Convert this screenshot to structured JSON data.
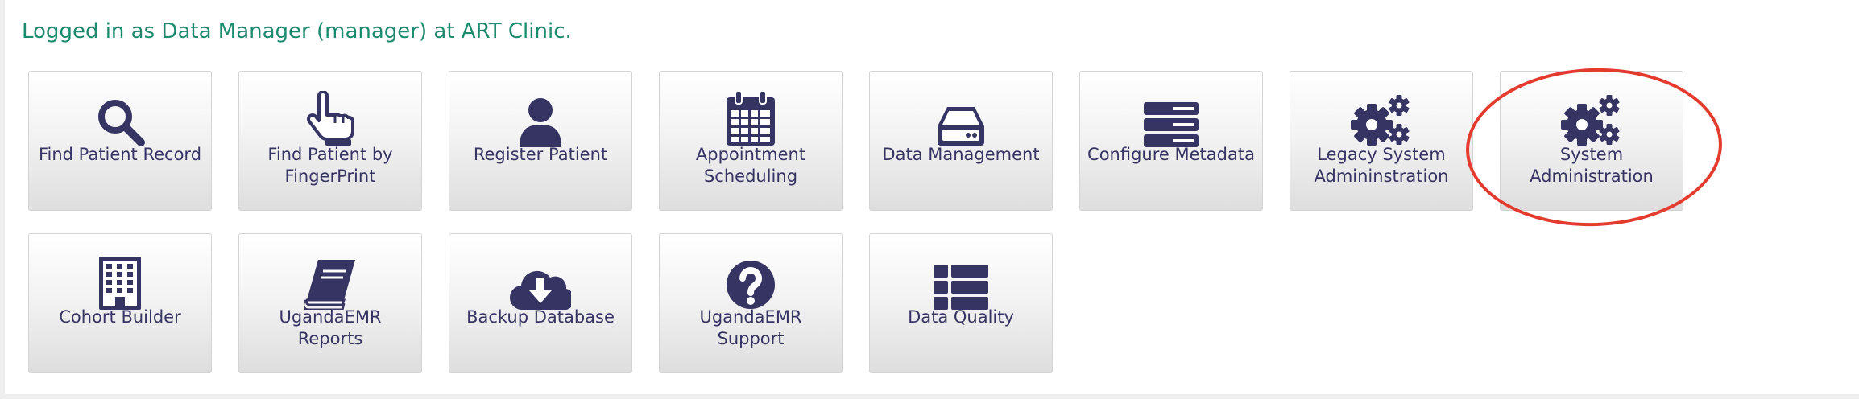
{
  "header": {
    "welcome": "Logged in as Data Manager (manager) at ART Clinic."
  },
  "colors": {
    "icon": "#363463",
    "welcome_text": "#1b8a6e",
    "highlight_ring": "#e33b2e"
  },
  "apps": [
    {
      "label": "Find Patient Record",
      "icon": "search-icon"
    },
    {
      "label": "Find Patient by FingerPrint",
      "icon": "pointing-hand-icon"
    },
    {
      "label": "Register Patient",
      "icon": "user-icon"
    },
    {
      "label": "Appointment Scheduling",
      "icon": "calendar-icon"
    },
    {
      "label": "Data Management",
      "icon": "hard-drive-icon"
    },
    {
      "label": "Configure Metadata",
      "icon": "server-icon"
    },
    {
      "label": "Legacy System Admininstration",
      "icon": "gears-icon"
    },
    {
      "label": "System Administration",
      "icon": "gears-icon"
    },
    {
      "label": "Cohort Builder",
      "icon": "building-icon"
    },
    {
      "label": "UgandaEMR Reports",
      "icon": "book-icon"
    },
    {
      "label": "Backup Database",
      "icon": "cloud-download-icon"
    },
    {
      "label": "UgandaEMR Support",
      "icon": "question-circle-icon"
    },
    {
      "label": "Data Quality",
      "icon": "list-icon"
    }
  ]
}
